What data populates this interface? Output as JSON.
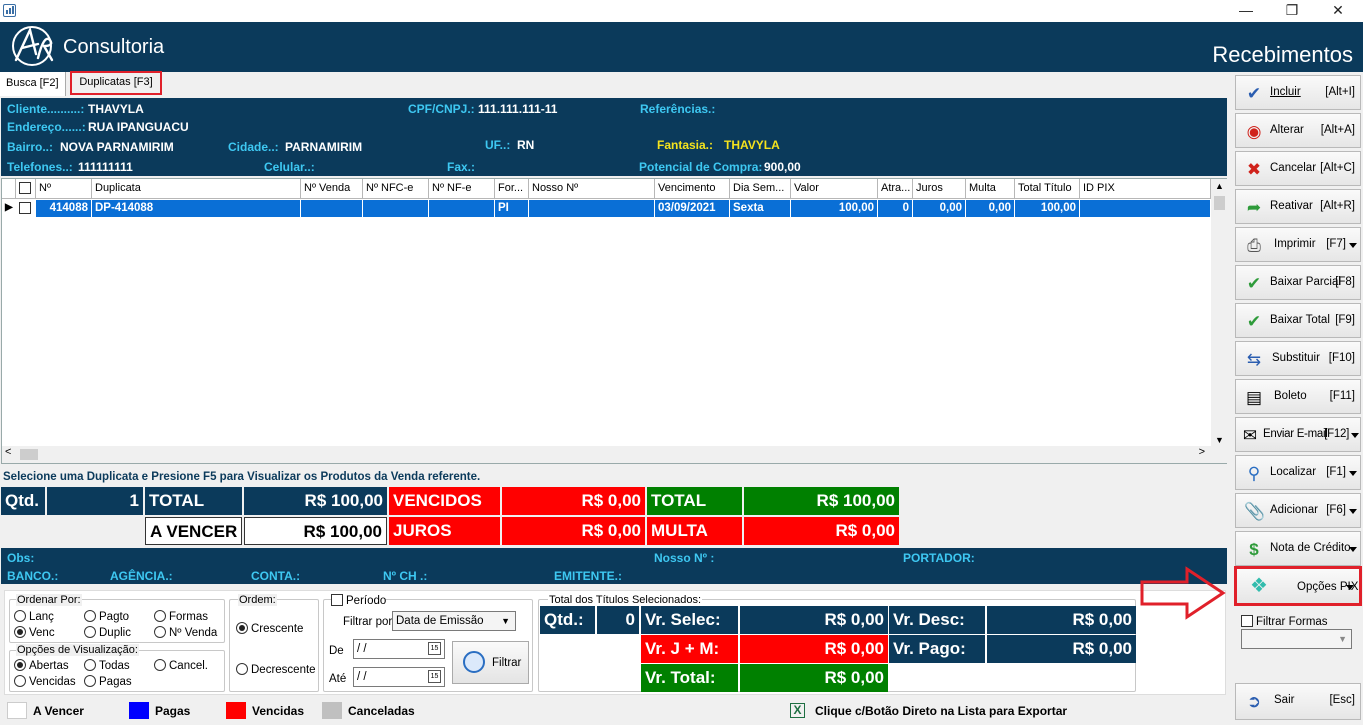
{
  "header": {
    "logo_text": "Consultoria",
    "module": "Recebimentos"
  },
  "tabs": [
    {
      "label": "Busca [F2]"
    },
    {
      "label": "Duplicatas [F3]"
    }
  ],
  "client": {
    "cliente_label": "Cliente..........:",
    "cliente": "THAVYLA",
    "cpf_label": "CPF/CNPJ.:",
    "cpf": "111.111.111-11",
    "ref_label": "Referências.:",
    "endereco_label": "Endereço......:",
    "endereco": "RUA IPANGUACU",
    "bairro_label": "Bairro..:",
    "bairro": "NOVA PARNAMIRIM",
    "cidade_label": "Cidade..:",
    "cidade": "PARNAMIRIM",
    "uf_label": "UF..:",
    "uf": "RN",
    "fantasia_label": "Fantasia.:",
    "fantasia": "THAVYLA",
    "telefones_label": "Telefones..:",
    "telefones": "111111111",
    "celular_label": "Celular..:",
    "fax_label": "Fax.:",
    "potencial_label": "Potencial de Compra:",
    "potencial": "900,00"
  },
  "grid": {
    "columns": [
      "Nº",
      "Duplicata",
      "Nº Venda",
      "Nº NFC-e",
      "Nº NF-e",
      "For...",
      "Nosso Nº",
      "Vencimento",
      "Dia Sem...",
      "Valor",
      "Atra...",
      "Juros",
      "Multa",
      "Total Título",
      "ID PIX"
    ],
    "row": {
      "n": "414088",
      "duplicata": "DP-414088",
      "venda": "",
      "nfce": "",
      "nfe": "",
      "forma": "PI",
      "nosso": "",
      "vencimento": "03/09/2021",
      "dia": "Sexta",
      "valor": "100,00",
      "atraso": "0",
      "juros": "0,00",
      "multa": "0,00",
      "total": "100,00",
      "pix": ""
    }
  },
  "hint": "Selecione uma Duplicata e Presione F5 para Visualizar os Produtos da Venda referente.",
  "totals": {
    "qtd_label": "Qtd.",
    "qtd": "1",
    "total_label": "TOTAL",
    "total": "R$ 100,00",
    "vencidos_label": "VENCIDOS",
    "vencidos": "R$ 0,00",
    "total2_label": "TOTAL",
    "total2": "R$ 100,00",
    "avencer_label": "A VENCER",
    "avencer": "R$ 100,00",
    "juros_label": "JUROS",
    "juros": "R$ 0,00",
    "multa_label": "MULTA",
    "multa": "R$ 0,00"
  },
  "obs": {
    "obs_label": "Obs:",
    "nosso_label": "Nosso Nº :",
    "portador_label": "PORTADOR:",
    "banco_label": "BANCO.:",
    "agencia_label": "AGÊNCIA.:",
    "conta_label": "CONTA.:",
    "nch_label": "Nº CH .:",
    "emitente_label": "EMITENTE.:"
  },
  "ordenar": {
    "title": "Ordenar Por:",
    "lanc": "Lanç",
    "pagto": "Pagto",
    "formas": "Formas",
    "venc": "Venc",
    "duplic": "Duplic",
    "nvenda": "Nº Venda"
  },
  "visual": {
    "title": "Opções de Visualização:",
    "abertas": "Abertas",
    "todas": "Todas",
    "cancel": "Cancel.",
    "vencidas": "Vencidas",
    "pagas": "Pagas"
  },
  "ordem": {
    "title": "Ordem:",
    "crescente": "Crescente",
    "decrescente": "Decrescente"
  },
  "periodo": {
    "label": "Período",
    "filtrar_label": "Filtrar por:",
    "filtrar_value": "Data de Emissão",
    "de_label": "De",
    "de_value": " / /",
    "ate_label": "Até",
    "ate_value": " / /",
    "filtrar_button": "Filtrar"
  },
  "selecionados": {
    "title": "Total dos Títulos Selecionados:",
    "qtd_label": "Qtd.:",
    "qtd": "0",
    "vr_selec_label": "Vr. Selec:",
    "vr_selec": "R$ 0,00",
    "vr_desc_label": "Vr. Desc:",
    "vr_desc": "R$ 0,00",
    "vr_jm_label": "Vr. J + M:",
    "vr_jm": "R$ 0,00",
    "vr_pago_label": "Vr. Pago:",
    "vr_pago": "R$ 0,00",
    "vr_total_label": "Vr. Total:",
    "vr_total": "R$ 0,00"
  },
  "sidebar": [
    {
      "label": "Incluir",
      "key": "[Alt+I]",
      "icon": "checkmark-icon"
    },
    {
      "label": "Alterar",
      "key": "[Alt+A]",
      "icon": "edit-icon"
    },
    {
      "label": "Cancelar",
      "key": "[Alt+C]",
      "icon": "close-icon"
    },
    {
      "label": "Reativar",
      "key": "[Alt+R]",
      "icon": "reactivate-icon"
    },
    {
      "label": "Imprimir",
      "key": "[F7]",
      "icon": "printer-icon"
    },
    {
      "label": "Baixar Parcial",
      "key": "[F8]",
      "icon": "checkmark-icon"
    },
    {
      "label": "Baixar Total",
      "key": "[F9]",
      "icon": "checkmark-icon"
    },
    {
      "label": "Substituir",
      "key": "[F10]",
      "icon": "swap-icon"
    },
    {
      "label": "Boleto",
      "key": "[F11]",
      "icon": "barcode-icon"
    },
    {
      "label": "Enviar E-mail",
      "key": "[F12]",
      "icon": "email-icon"
    },
    {
      "label": "Localizar",
      "key": "[F1]",
      "icon": "search-icon"
    },
    {
      "label": "Adicionar",
      "key": "[F6]",
      "icon": "paperclip-icon"
    },
    {
      "label": "Nota de Crédito",
      "key": "",
      "icon": "money-icon"
    },
    {
      "label": "Opções PIX",
      "key": "",
      "icon": "pix-icon"
    }
  ],
  "filtrar_formas": "Filtrar Formas",
  "sair": {
    "label": "Sair",
    "key": "[Esc]"
  },
  "legend": {
    "avencer": "A Vencer",
    "pagas": "Pagas",
    "vencidas": "Vencidas",
    "canceladas": "Canceladas",
    "export": "Clique c/Botão Direto na Lista para Exportar"
  },
  "colors": {
    "navy": "#0b3a5b",
    "red": "#ff0000",
    "green": "#008000",
    "blue": "#0000ff",
    "highlight": "#e0202a",
    "row": "#0a6fd6"
  }
}
